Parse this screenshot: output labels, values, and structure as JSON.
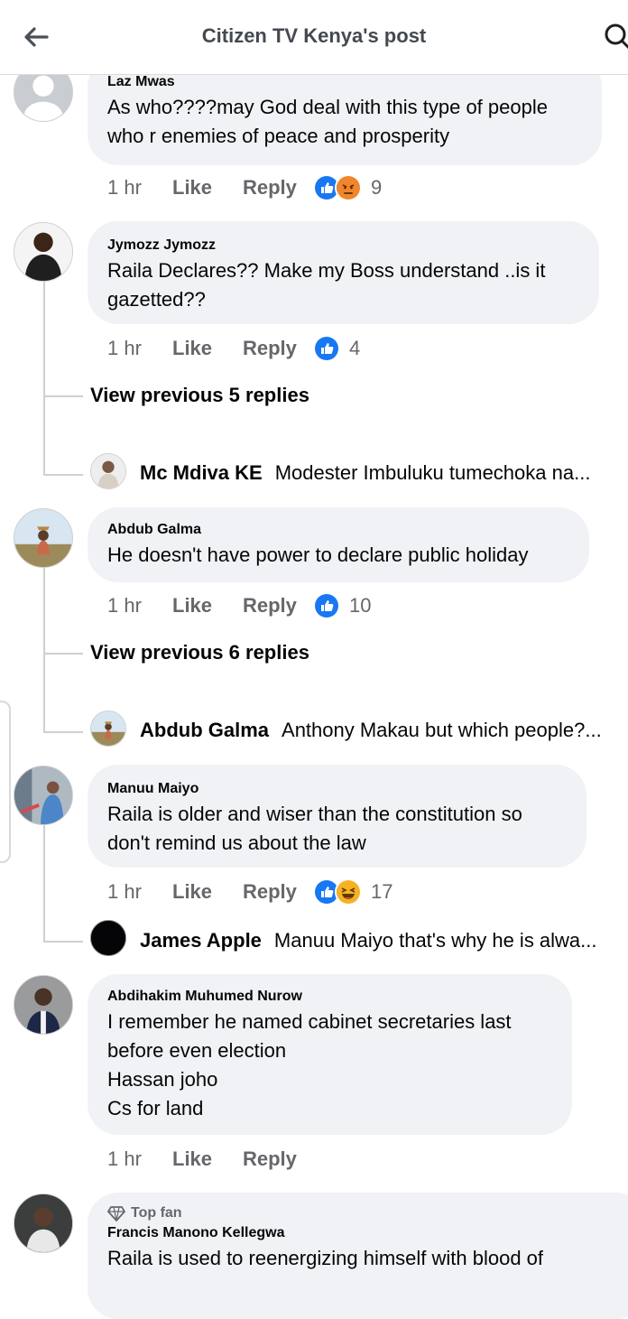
{
  "header": {
    "title": "Citizen TV Kenya's post"
  },
  "labels": {
    "like": "Like",
    "reply": "Reply",
    "top_fan": "Top fan"
  },
  "comments": [
    {
      "author": "Laz Mwas",
      "text": "As who????may God deal with this type of people who r enemies of peace and prosperity",
      "time": "1 hr",
      "reaction_count": "9",
      "reactions": [
        "like",
        "angry"
      ]
    },
    {
      "author": "Jymozz Jymozz",
      "text": "Raila Declares?? Make my Boss understand ..is it gazetted??",
      "time": "1 hr",
      "reaction_count": "4",
      "reactions": [
        "like"
      ],
      "view_previous": "View previous 5 replies",
      "reply": {
        "author": "Mc Mdiva KE",
        "text": "Modester Imbuluku tumechoka na..."
      }
    },
    {
      "author": "Abdub Galma",
      "text": "He doesn't have power to declare public holiday",
      "time": "1 hr",
      "reaction_count": "10",
      "reactions": [
        "like"
      ],
      "view_previous": "View previous 6 replies",
      "reply": {
        "author": "Abdub Galma",
        "text": "Anthony Makau but which people?..."
      }
    },
    {
      "author": "Manuu Maiyo",
      "text": "Raila is older and wiser than the constitution so don't remind us about the law",
      "time": "1 hr",
      "reaction_count": "17",
      "reactions": [
        "like",
        "haha"
      ],
      "reply": {
        "author": "James Apple",
        "text": "Manuu Maiyo that's why he is alwa..."
      }
    },
    {
      "author": "Abdihakim Muhumed Nurow",
      "text_lines": [
        "I remember he named cabinet secretaries last",
        "before even election",
        "Hassan joho",
        "Cs for land"
      ],
      "time": "1 hr"
    },
    {
      "author": "Francis Manono Kellegwa",
      "badge": "Top fan",
      "text": "Raila is used to  reenergizing himself with blood of"
    }
  ],
  "colors": {
    "like_blue": "#1877f2",
    "angry_orange": "#f0852d",
    "haha_yellow": "#f7b125",
    "bubble_bg": "#f0f2f5",
    "meta_gray": "#65676b"
  }
}
